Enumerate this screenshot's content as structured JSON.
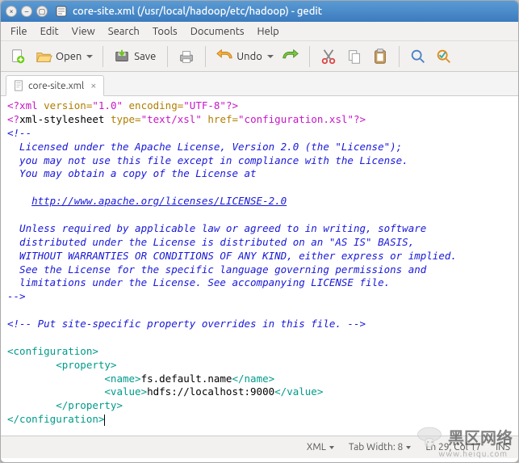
{
  "window": {
    "title": "core-site.xml (/usr/local/hadoop/etc/hadoop) - gedit",
    "btn_minimize": "–",
    "btn_maximize": "▢",
    "btn_close": "×"
  },
  "menubar": [
    "File",
    "Edit",
    "View",
    "Search",
    "Tools",
    "Documents",
    "Help"
  ],
  "toolbar": {
    "open_label": "Open",
    "save_label": "Save",
    "undo_label": "Undo"
  },
  "tab": {
    "name": "core-site.xml",
    "close": "×"
  },
  "code": {
    "l1a": "<?xml ",
    "l1b": "version=",
    "l1c": "\"1.0\" ",
    "l1d": "encoding=",
    "l1e": "\"UTF-8\"",
    "l1f": "?>",
    "l2a": "<?",
    "l2b": "xml-stylesheet ",
    "l2c": "type=",
    "l2d": "\"text/xsl\" ",
    "l2e": "href=",
    "l2f": "\"configuration.xsl\"",
    "l2g": "?>",
    "l3": "<!--",
    "l4": "  Licensed under the Apache License, Version 2.0 (the \"License\");",
    "l5": "  you may not use this file except in compliance with the License.",
    "l6": "  You may obtain a copy of the License at",
    "l7a": "    ",
    "l7b": "http://www.apache.org/licenses/LICENSE-2.0",
    "l8": "  Unless required by applicable law or agreed to in writing, software",
    "l9": "  distributed under the License is distributed on an \"AS IS\" BASIS,",
    "l10": "  WITHOUT WARRANTIES OR CONDITIONS OF ANY KIND, either express or implied.",
    "l11": "  See the License for the specific language governing permissions and",
    "l12": "  limitations under the License. See accompanying LICENSE file.",
    "l13": "-->",
    "l14": "<!-- Put site-specific property overrides in this file. -->",
    "cfg_open": "<configuration>",
    "prop_open": "        <property>",
    "name_open": "                <name>",
    "name_text": "fs.default.name",
    "name_close": "</name>",
    "value_open": "                <value>",
    "value_text": "hdfs://localhost:9000",
    "value_close": "</value>",
    "prop_close": "        </property>",
    "cfg_close": "</configuration>"
  },
  "status": {
    "lang": "XML",
    "tabwidth": "Tab Width: 8",
    "pos": "Ln 29, Col 17",
    "ins": "INS"
  },
  "watermark": {
    "text": "黑区网络",
    "url": "www.heiqu.com"
  }
}
